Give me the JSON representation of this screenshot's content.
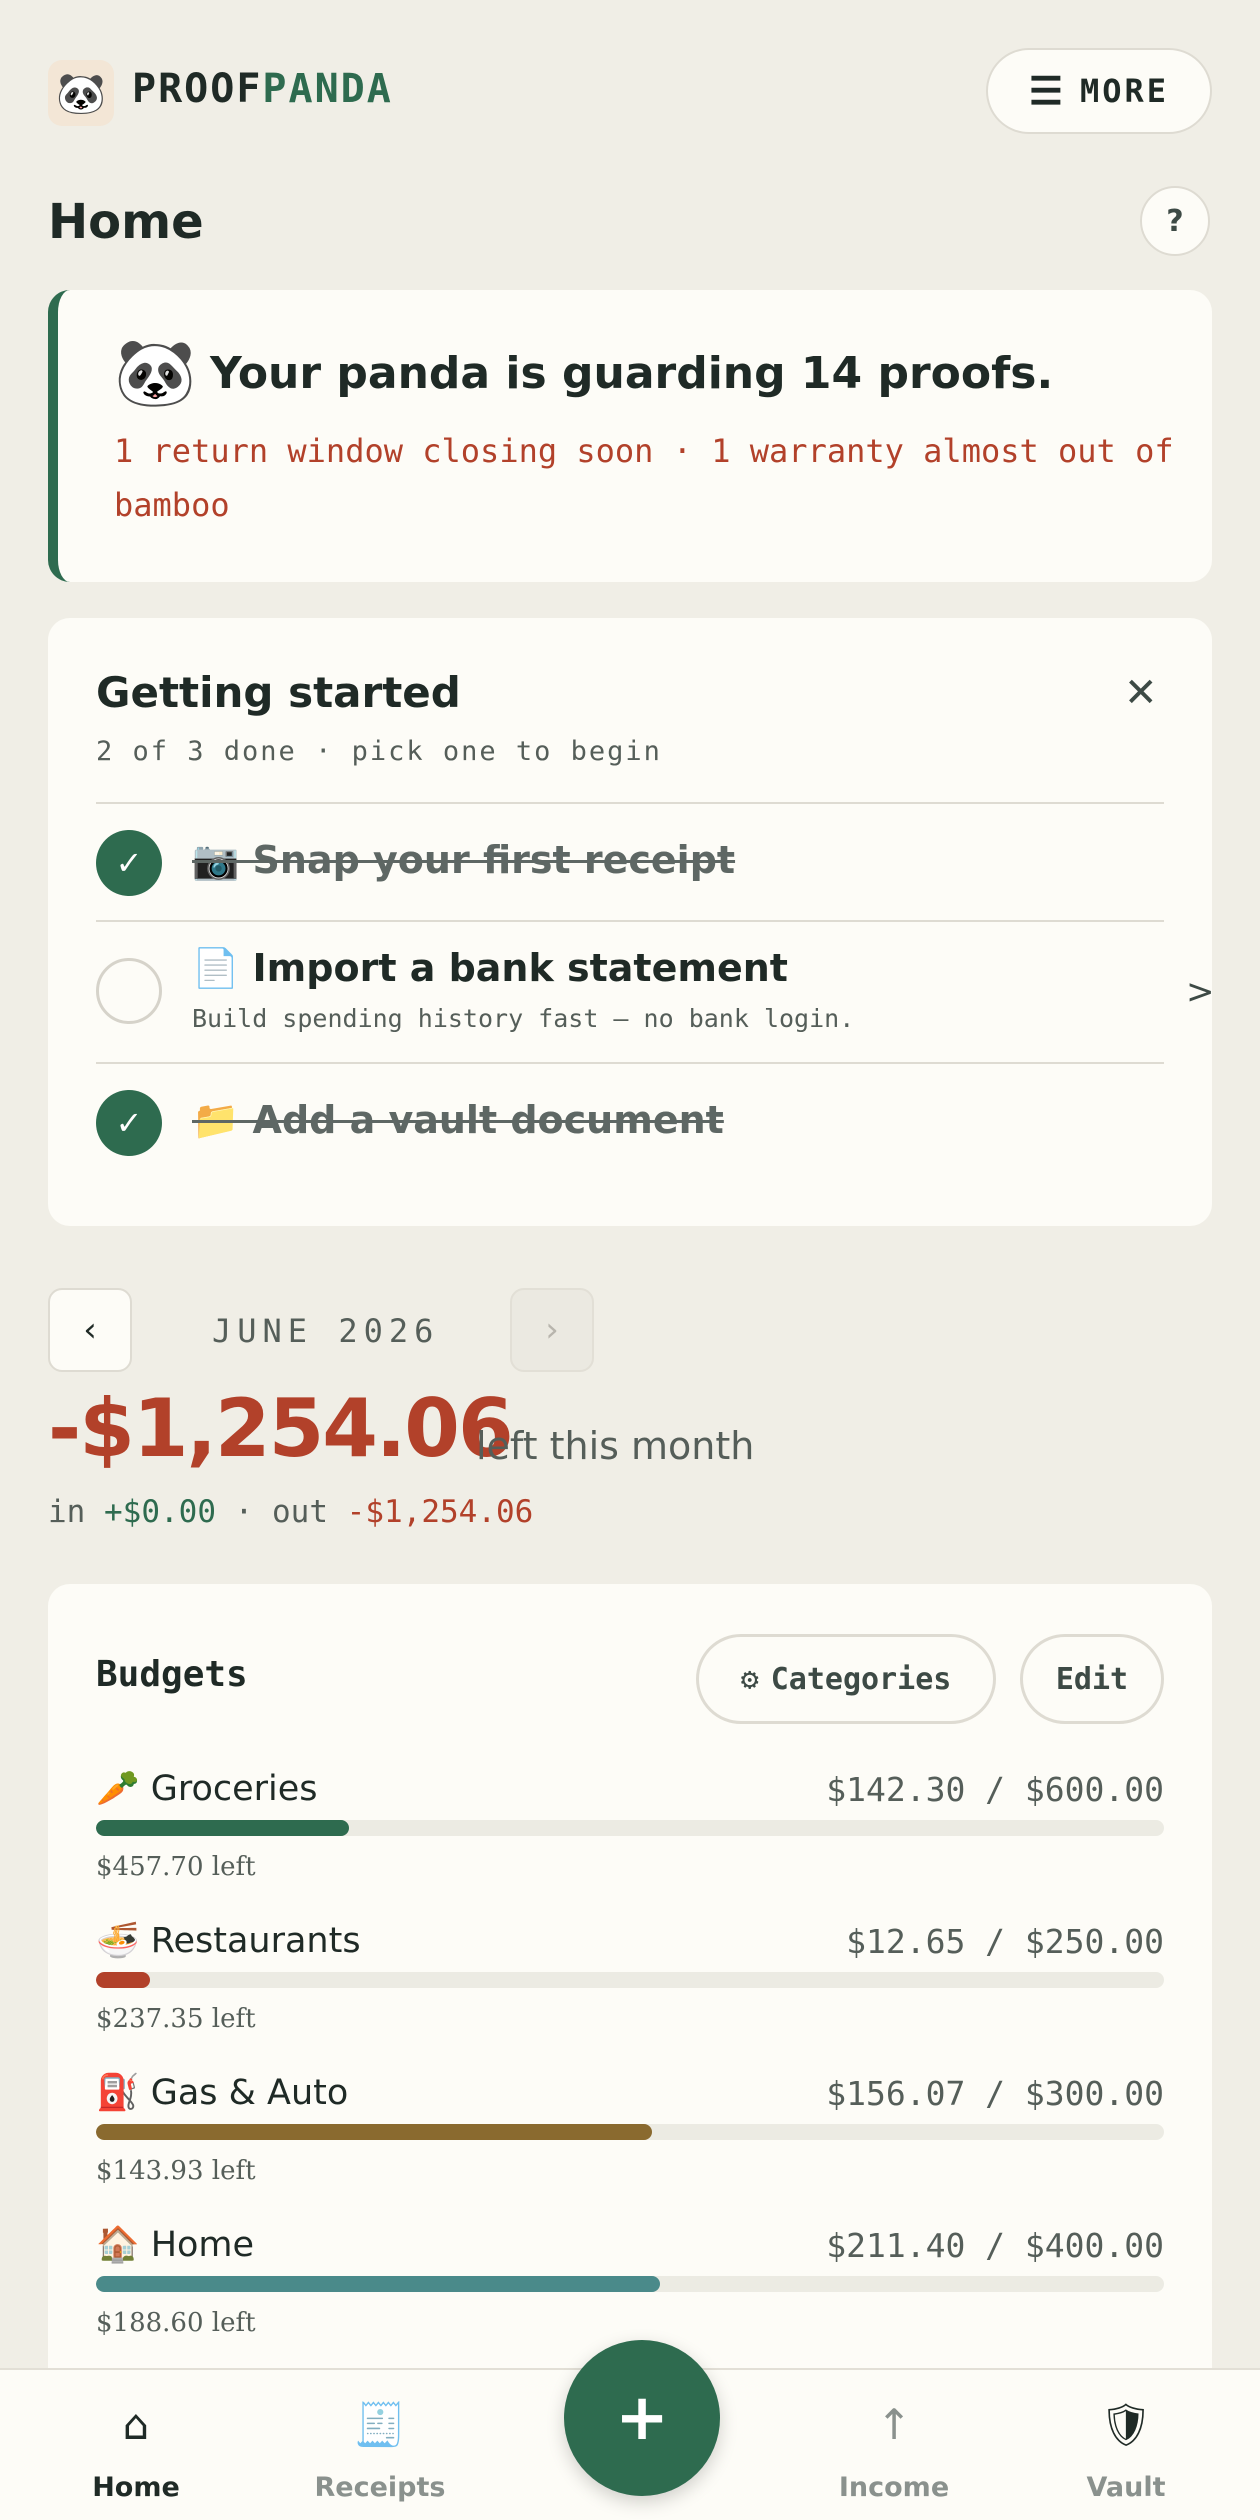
{
  "header": {
    "logo_emoji": "🐼",
    "brand_part1": "PROOF",
    "brand_part2": "PANDA",
    "more_icon": "☰",
    "more_label": "MORE"
  },
  "page": {
    "title": "Home",
    "help_label": "?"
  },
  "status_card": {
    "emoji": "🐼",
    "headline": "Your panda is guarding 14 proofs.",
    "alerts": "1 return window closing soon · 1 warranty almost out of bamboo"
  },
  "getting_started": {
    "title": "Getting started",
    "close_icon": "✕",
    "subtitle": "2 of 3 done · pick one to begin",
    "items": [
      {
        "emoji": "📷",
        "label": "📷 Snap your first receipt",
        "done": true,
        "check": "✓"
      },
      {
        "emoji": "📄",
        "label": "📄 Import a bank statement",
        "desc": "Build spending history fast — no bank login.",
        "done": false,
        "chevron": ">"
      },
      {
        "emoji": "📁",
        "label": "📁 Add a vault document",
        "done": true,
        "check": "✓"
      }
    ]
  },
  "month": {
    "prev_icon": "‹",
    "label": "JUNE 2026",
    "next_icon": "›",
    "balance": "-$1,254.06",
    "balance_suffix": "left this month",
    "in_label": "in",
    "in_value": "+$0.00",
    "sep": "·",
    "out_label": "out",
    "out_value": "-$1,254.06"
  },
  "budgets": {
    "title": "Budgets",
    "categories_icon": "⚙",
    "categories_label": "Categories",
    "edit_label": "Edit",
    "items": [
      {
        "name": "🥕 Groceries",
        "amount": "$142.30 / $600.00",
        "spent": 142.3,
        "limit": 600.0,
        "left": "$457.70 left",
        "color": "#2e6b4f"
      },
      {
        "name": "🍜 Restaurants",
        "amount": "$12.65 / $250.00",
        "spent": 12.65,
        "limit": 250.0,
        "left": "$237.35 left",
        "color": "#b2412a"
      },
      {
        "name": "⛽ Gas & Auto",
        "amount": "$156.07 / $300.00",
        "spent": 156.07,
        "limit": 300.0,
        "left": "$143.93 left",
        "color": "#8a6a2f"
      },
      {
        "name": "🏠 Home",
        "amount": "$211.40 / $400.00",
        "spent": 211.4,
        "limit": 400.0,
        "left": "$188.60 left",
        "color": "#4a8a8a"
      }
    ]
  },
  "bottom_nav": {
    "items": [
      {
        "icon": "⌂",
        "label": "Home",
        "active": true
      },
      {
        "icon": "🧾",
        "label": "Receipts",
        "active": false
      },
      {
        "icon": "↑",
        "label": "Income",
        "active": false
      },
      {
        "icon": "🛡",
        "label": "Vault",
        "active": false
      }
    ],
    "fab_icon": "+"
  }
}
